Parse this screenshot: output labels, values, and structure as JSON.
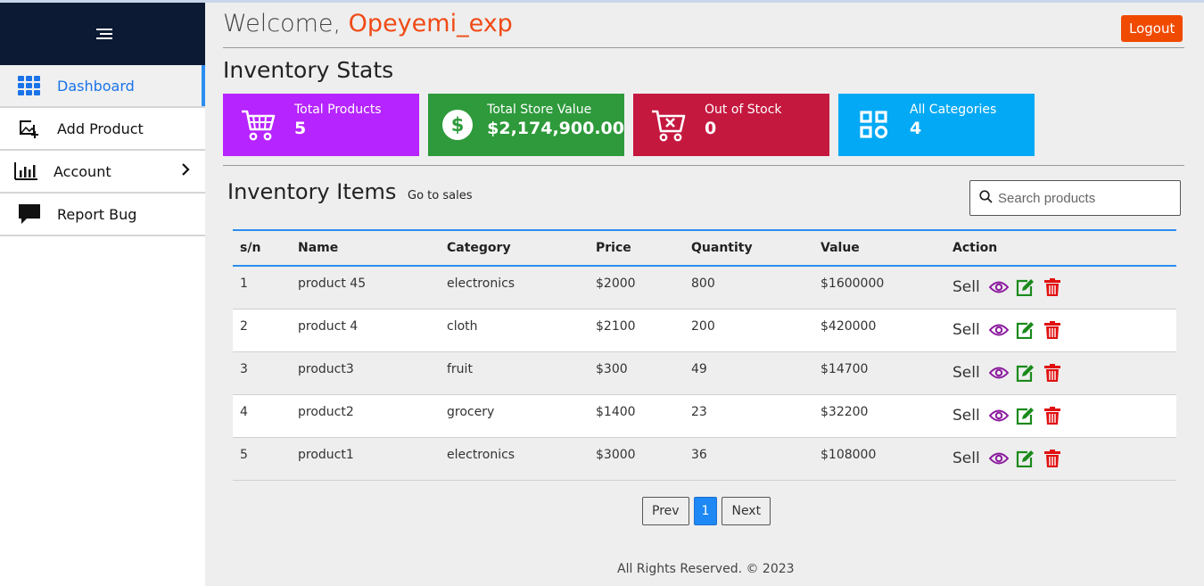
{
  "sidebar": {
    "items": [
      {
        "label": "Dashboard"
      },
      {
        "label": "Add Product"
      },
      {
        "label": "Account"
      },
      {
        "label": "Report Bug"
      }
    ]
  },
  "header": {
    "welcome_prefix": "Welcome, ",
    "username": "Opeyemi_exp",
    "logout_label": "Logout"
  },
  "stats": {
    "title": "Inventory Stats",
    "cards": [
      {
        "label": "Total Products",
        "value": "5",
        "color": "#b624ff",
        "icon": "cart-icon"
      },
      {
        "label": "Total Store Value",
        "value": "$2,174,900.00",
        "color": "#2e9a3b",
        "icon": "dollar-icon"
      },
      {
        "label": "Out of Stock",
        "value": "0",
        "color": "#c5183f",
        "icon": "cart-x-icon"
      },
      {
        "label": "All Categories",
        "value": "4",
        "color": "#03a9f4",
        "icon": "categories-icon"
      }
    ]
  },
  "inventory": {
    "title": "Inventory Items",
    "go_to_sales": "Go to sales",
    "search_placeholder": "Search products",
    "columns": [
      "s/n",
      "Name",
      "Category",
      "Price",
      "Quantity",
      "Value",
      "Action"
    ],
    "rows": [
      {
        "sn": "1",
        "name": "product 45",
        "category": "electronics",
        "price": "$2000",
        "quantity": "800",
        "value": "$1600000",
        "sell": "Sell"
      },
      {
        "sn": "2",
        "name": "product 4",
        "category": "cloth",
        "price": "$2100",
        "quantity": "200",
        "value": "$420000",
        "sell": "Sell"
      },
      {
        "sn": "3",
        "name": "product3",
        "category": "fruit",
        "price": "$300",
        "quantity": "49",
        "value": "$14700",
        "sell": "Sell"
      },
      {
        "sn": "4",
        "name": "product2",
        "category": "grocery",
        "price": "$1400",
        "quantity": "23",
        "value": "$32200",
        "sell": "Sell"
      },
      {
        "sn": "5",
        "name": "product1",
        "category": "electronics",
        "price": "$3000",
        "quantity": "36",
        "value": "$108000",
        "sell": "Sell"
      }
    ]
  },
  "pagination": {
    "prev": "Prev",
    "current": "1",
    "next": "Next"
  },
  "footer": {
    "text": "All Rights Reserved. © 2023"
  },
  "colors": {
    "sidebar_head": "#0c1a33",
    "accent_blue": "#2b8ef0",
    "logout": "#f04a00",
    "view_icon": "#8b1a9e",
    "edit_icon": "#1a8a1a",
    "delete_icon": "#e01010"
  }
}
